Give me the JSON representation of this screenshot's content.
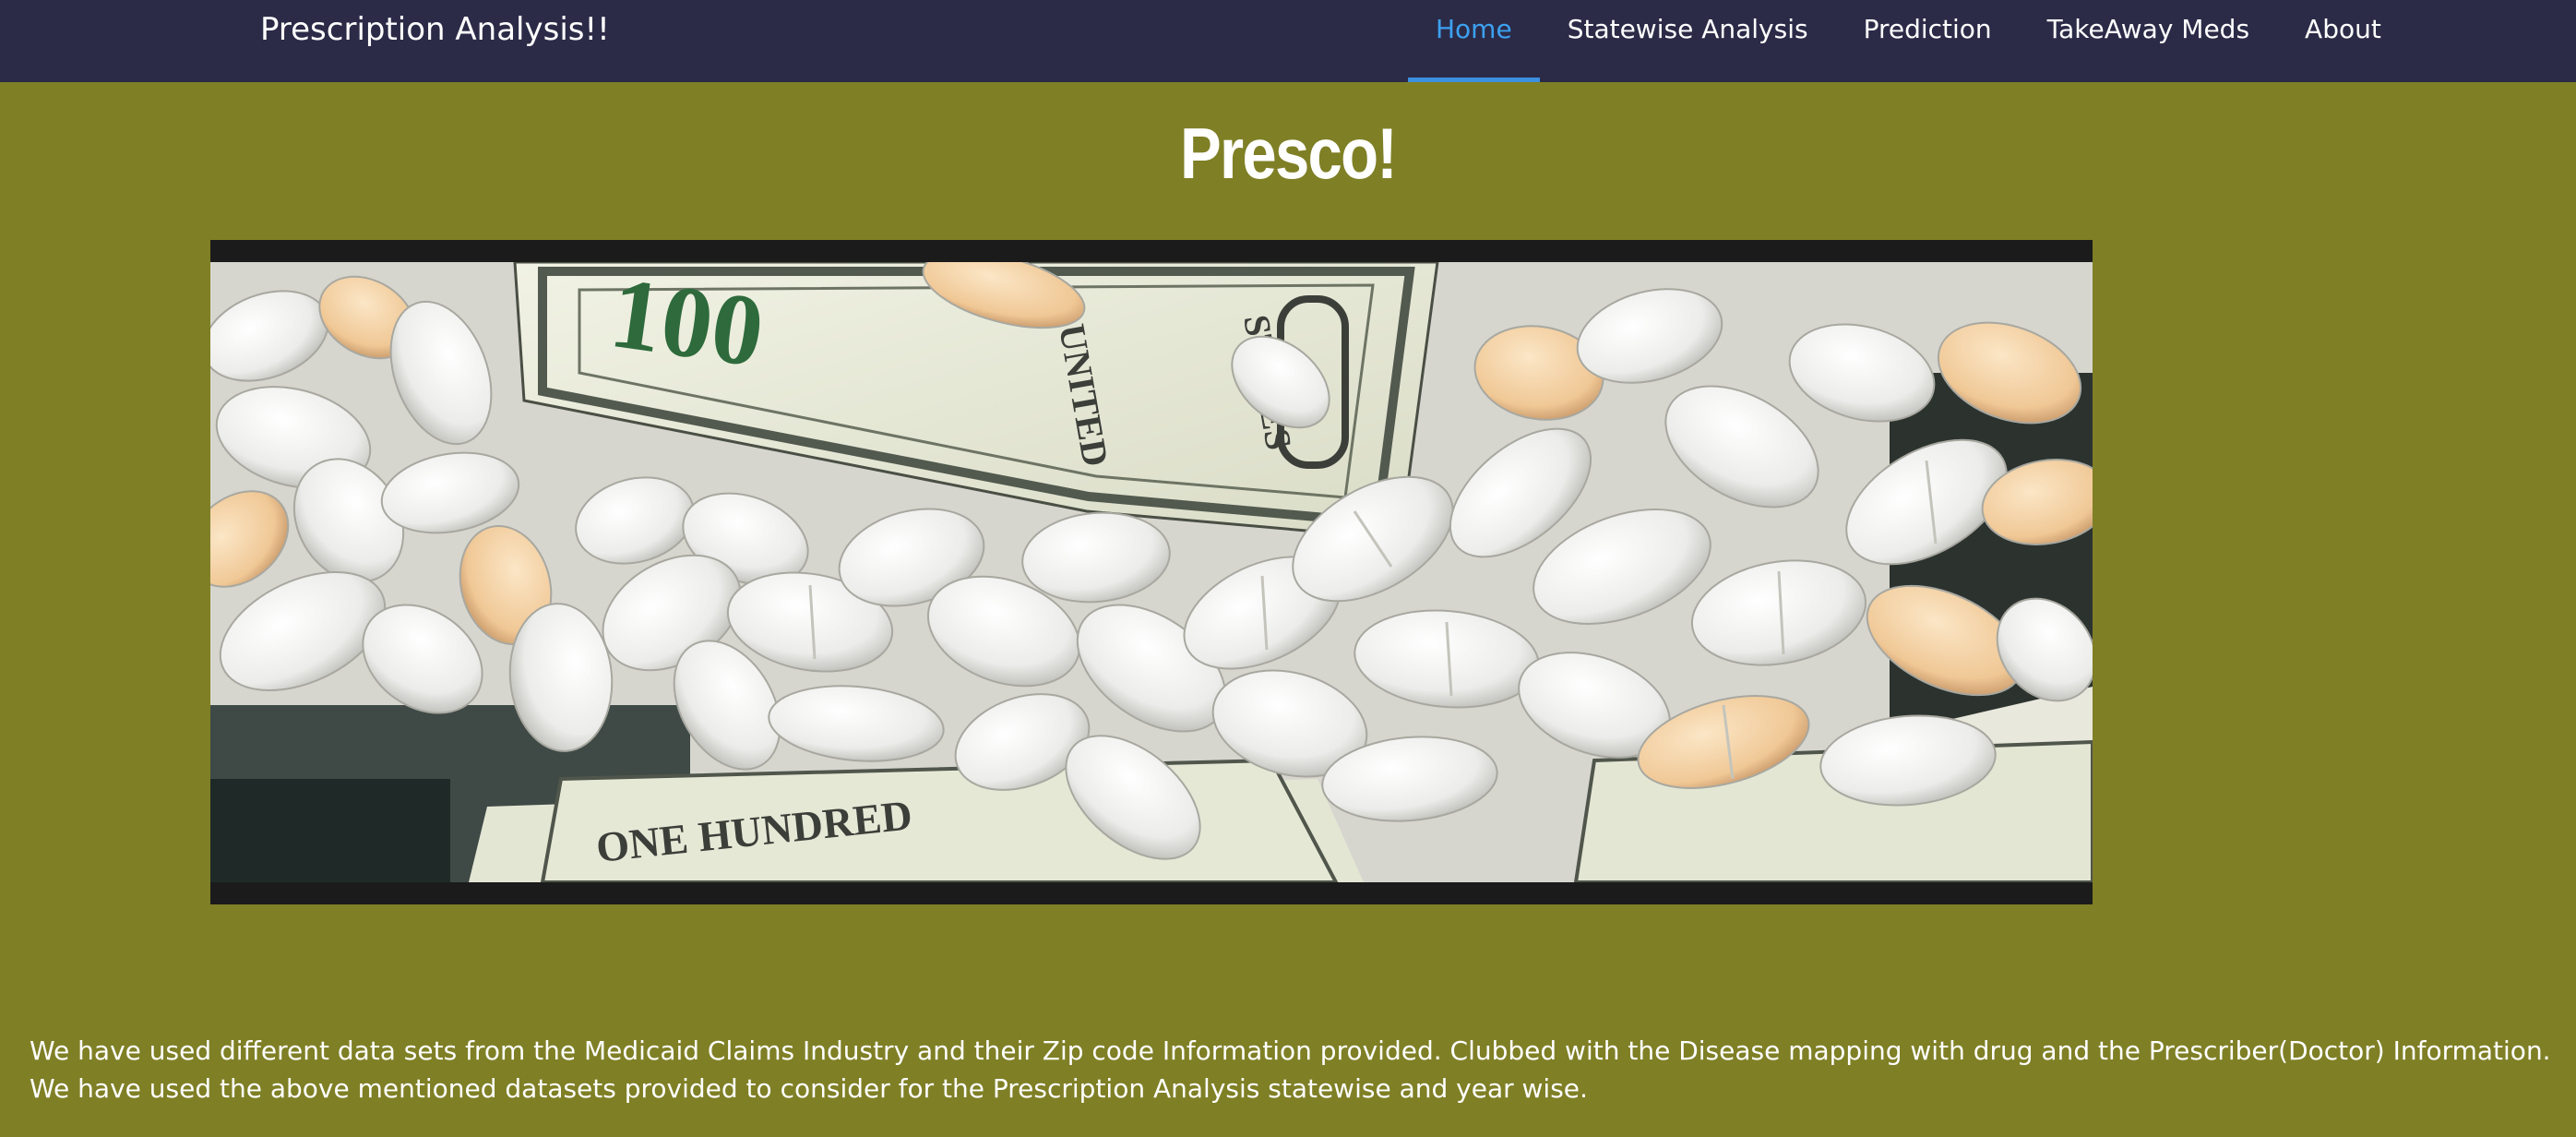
{
  "navbar": {
    "brand": "Prescription Analysis!!",
    "links": [
      {
        "label": "Home",
        "active": true
      },
      {
        "label": "Statewise Analysis",
        "active": false
      },
      {
        "label": "Prediction",
        "active": false
      },
      {
        "label": "TakeAway Meds",
        "active": false
      },
      {
        "label": "About",
        "active": false
      }
    ]
  },
  "main": {
    "title": "Presco!",
    "hero_image": {
      "banknote_text_1": "ONE HUNDRED",
      "banknote_text_2": "100"
    },
    "description": "We have used different data sets from the Medicaid Claims Industry and their Zip code Information provided. Clubbed with the Disease mapping with drug and the Prescriber(Doctor) Information. We have used the above mentioned datasets provided to consider for the Prescription Analysis statewise and year wise."
  },
  "colors": {
    "navbar_bg": "#2b2b48",
    "page_bg": "#7f7f26",
    "active_link": "#3da1f0",
    "text": "#ffffff"
  }
}
